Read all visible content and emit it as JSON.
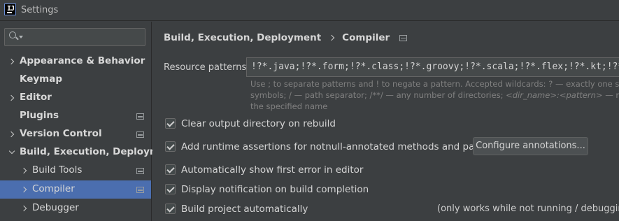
{
  "window": {
    "title": "Settings",
    "app_icon": "intellij-idea-icon"
  },
  "sidebar": {
    "search": {
      "value": "",
      "placeholder": ""
    },
    "items": [
      {
        "label": "Appearance & Behavior",
        "level": 0,
        "expanded": false,
        "has_children": true,
        "project_icon": false,
        "selected": false
      },
      {
        "label": "Keymap",
        "level": 0,
        "has_children": false,
        "project_icon": false,
        "selected": false
      },
      {
        "label": "Editor",
        "level": 0,
        "expanded": false,
        "has_children": true,
        "project_icon": false,
        "selected": false
      },
      {
        "label": "Plugins",
        "level": 0,
        "has_children": false,
        "project_icon": true,
        "selected": false
      },
      {
        "label": "Version Control",
        "level": 0,
        "expanded": false,
        "has_children": true,
        "project_icon": true,
        "selected": false
      },
      {
        "label": "Build, Execution, Deployment",
        "level": 0,
        "expanded": true,
        "has_children": true,
        "project_icon": false,
        "selected": false
      },
      {
        "label": "Build Tools",
        "level": 1,
        "expanded": false,
        "has_children": true,
        "project_icon": true,
        "selected": false
      },
      {
        "label": "Compiler",
        "level": 1,
        "expanded": false,
        "has_children": true,
        "project_icon": true,
        "selected": true
      },
      {
        "label": "Debugger",
        "level": 1,
        "expanded": false,
        "has_children": true,
        "project_icon": false,
        "selected": false
      }
    ]
  },
  "main": {
    "breadcrumb": {
      "parent": "Build, Execution, Deployment",
      "current": "Compiler"
    },
    "resource_patterns": {
      "label": "Resource patterns:",
      "value": "!?*.java;!?*.form;!?*.class;!?*.groovy;!?*.scala;!?*.flex;!?*.kt;!?*.clj"
    },
    "hint": {
      "line1": "Use ; to separate patterns and ! to negate a pattern. Accepted wildcards: ? — exactly one symbol; * — zero or more",
      "line2_a": "symbols; / — path separator; /**/ — any number of directories; ",
      "line2_b": "<dir_name>:<pattern>",
      "line2_c": " — restrict to source roots with",
      "line3": "the specified name"
    },
    "checkboxes": [
      {
        "label": "Clear output directory on rebuild",
        "checked": true
      },
      {
        "label": "Add runtime assertions for notnull-annotated methods and parameters",
        "checked": true
      },
      {
        "label": "Automatically show first error in editor",
        "checked": true
      },
      {
        "label": "Display notification on build completion",
        "checked": true
      },
      {
        "label": "Build project automatically",
        "checked": true
      }
    ],
    "configure_button": "Configure annotations...",
    "auto_build_note": "(only works while not running / debugging)"
  },
  "colors": {
    "background": "#3c3f41",
    "selection": "#4b6eaf",
    "input_bg": "#45494a",
    "text": "#d4d4d4",
    "hint_text": "#808080"
  }
}
